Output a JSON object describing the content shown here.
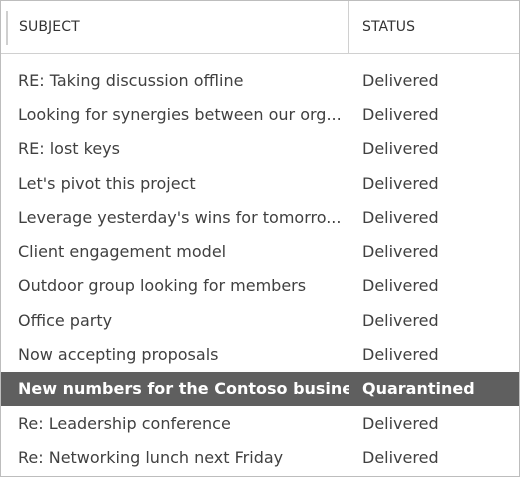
{
  "columns": {
    "subject": "SUBJECT",
    "status": "STATUS"
  },
  "rows": [
    {
      "subject": "RE: Taking discussion offline",
      "status": "Delivered",
      "selected": false
    },
    {
      "subject": "Looking for synergies between our org...",
      "status": "Delivered",
      "selected": false
    },
    {
      "subject": "RE: lost keys",
      "status": "Delivered",
      "selected": false
    },
    {
      "subject": "Let's pivot this project",
      "status": "Delivered",
      "selected": false
    },
    {
      "subject": "Leverage yesterday's wins for tomorro...",
      "status": "Delivered",
      "selected": false
    },
    {
      "subject": "Client engagement model",
      "status": "Delivered",
      "selected": false
    },
    {
      "subject": "Outdoor group looking for members",
      "status": "Delivered",
      "selected": false
    },
    {
      "subject": "Office party",
      "status": "Delivered",
      "selected": false
    },
    {
      "subject": "Now accepting proposals",
      "status": "Delivered",
      "selected": false
    },
    {
      "subject": "New numbers for the Contoso busine...",
      "status": "Quarantined",
      "selected": true
    },
    {
      "subject": "Re: Leadership conference",
      "status": "Delivered",
      "selected": false
    },
    {
      "subject": "Re: Networking lunch next Friday",
      "status": "Delivered",
      "selected": false
    }
  ],
  "colors": {
    "selected_row_background": "#5f5f5f",
    "selected_row_text": "#ffffff",
    "row_text": "#404040"
  }
}
